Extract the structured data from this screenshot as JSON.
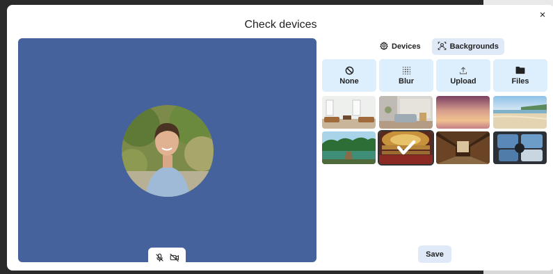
{
  "dialog": {
    "title": "Check devices",
    "close_label": "×"
  },
  "preview": {
    "background_color": "#45629d",
    "controls": [
      {
        "name": "mic-muted-icon"
      },
      {
        "name": "camera-off-icon"
      }
    ]
  },
  "tabs": [
    {
      "label": "Devices",
      "icon": "gear-icon",
      "active": false
    },
    {
      "label": "Backgrounds",
      "icon": "portrait-icon",
      "active": true
    }
  ],
  "options": [
    {
      "label": "None",
      "icon": "no-entry-icon"
    },
    {
      "label": "Blur",
      "icon": "blur-icon"
    },
    {
      "label": "Upload",
      "icon": "upload-icon"
    },
    {
      "label": "Files",
      "icon": "folder-icon"
    }
  ],
  "thumbnails": [
    {
      "scene": "living-room"
    },
    {
      "scene": "lounge"
    },
    {
      "scene": "sunset-sky"
    },
    {
      "scene": "beach"
    },
    {
      "scene": "lake"
    },
    {
      "scene": "theater",
      "selected": true
    },
    {
      "scene": "library"
    },
    {
      "scene": "space-station"
    }
  ],
  "save_label": "Save",
  "colors": {
    "accent_bg": "#ddeefc",
    "tab_active_bg": "#dfe9f7"
  }
}
